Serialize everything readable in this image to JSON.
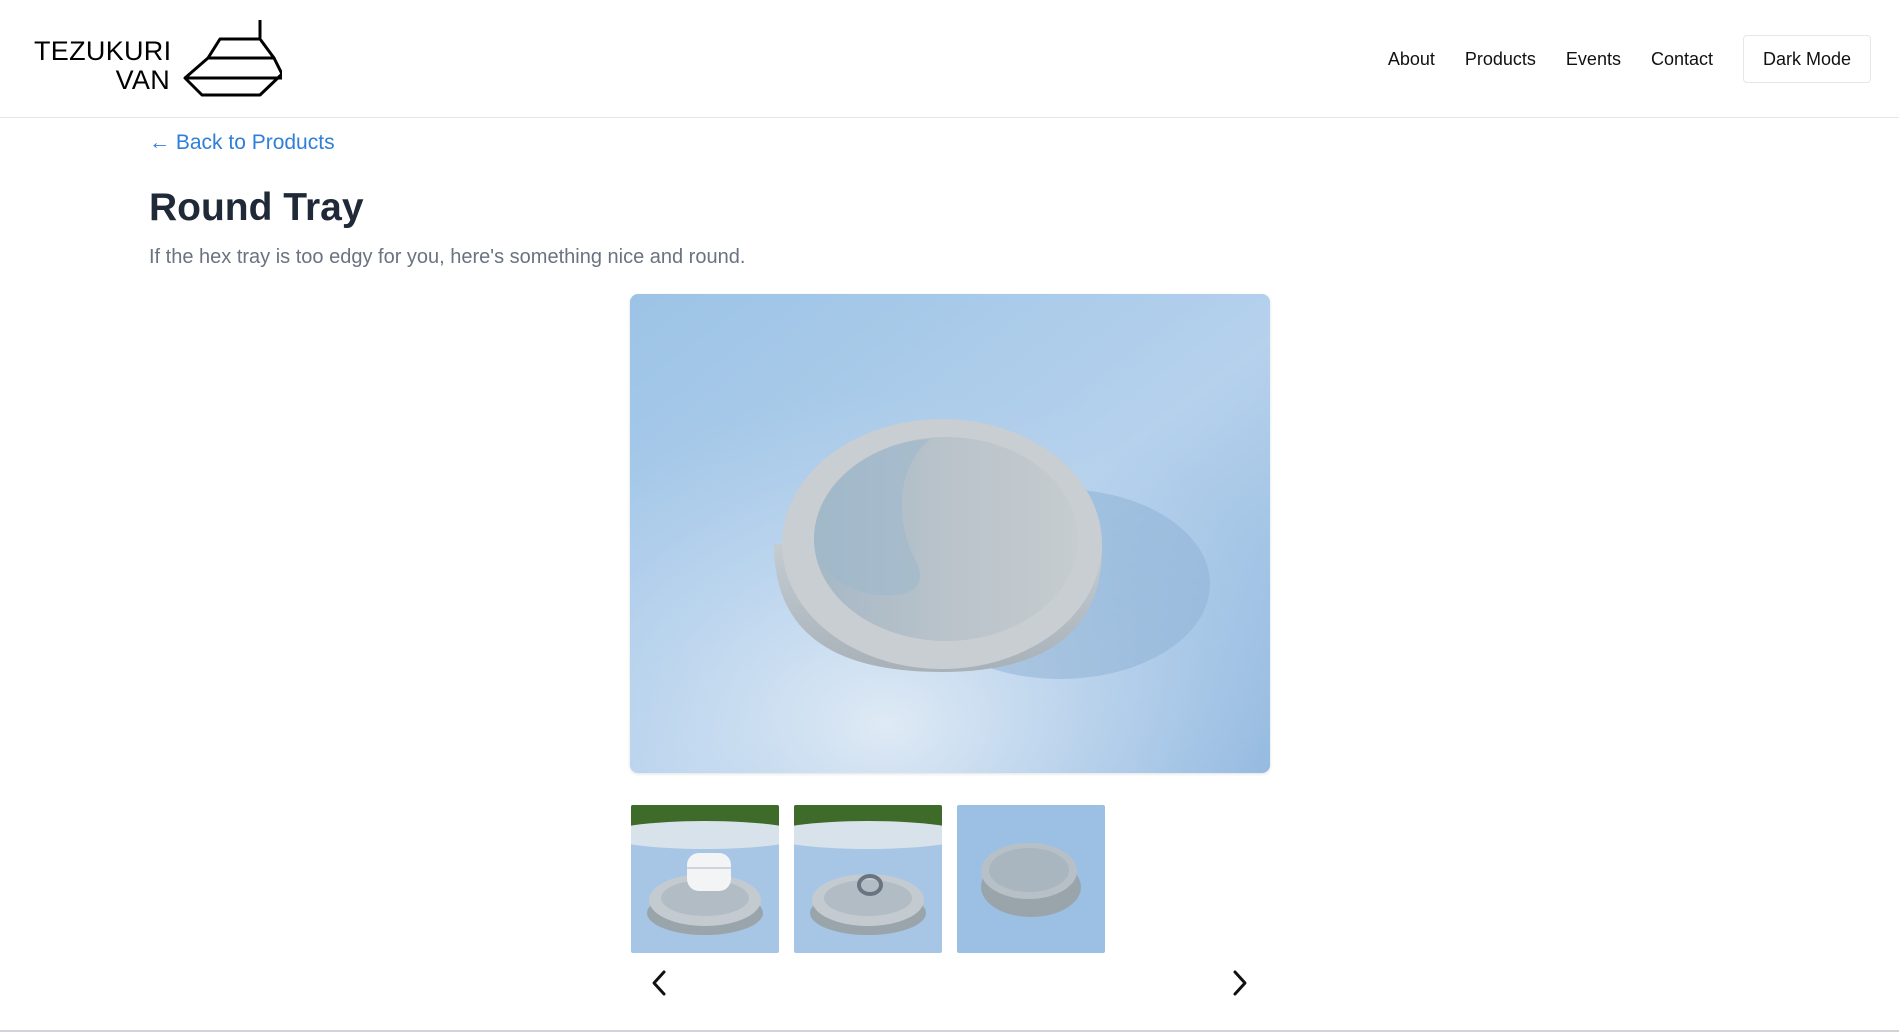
{
  "brand": {
    "line1": "TEZUKURI",
    "line2": "VAN"
  },
  "nav": {
    "items": [
      "About",
      "Products",
      "Events",
      "Contact"
    ],
    "dark_mode_label": "Dark Mode"
  },
  "back_link": "← Back to Products",
  "product": {
    "title": "Round Tray",
    "description": "If the hex tray is too edgy for you, here's something nice and round."
  },
  "gallery": {
    "thumbnails": [
      "tray-with-earbuds-case",
      "tray-with-ring",
      "empty-round-tray"
    ],
    "prev_icon": "chevron-left-icon",
    "next_icon": "chevron-right-icon"
  }
}
